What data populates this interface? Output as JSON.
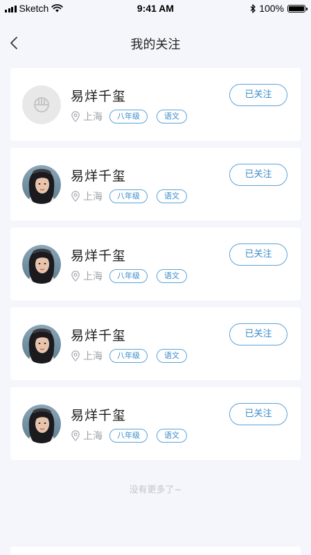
{
  "status_bar": {
    "carrier": "Sketch",
    "time": "9:41 AM",
    "battery": "100%"
  },
  "header": {
    "title": "我的关注"
  },
  "follows": [
    {
      "name": "易烊千玺",
      "city": "上海",
      "grade": "八年级",
      "subject": "语文",
      "button": "已关注",
      "avatar": "placeholder-logo"
    },
    {
      "name": "易烊千玺",
      "city": "上海",
      "grade": "八年级",
      "subject": "语文",
      "button": "已关注",
      "avatar": "photo"
    },
    {
      "name": "易烊千玺",
      "city": "上海",
      "grade": "八年级",
      "subject": "语文",
      "button": "已关注",
      "avatar": "photo"
    },
    {
      "name": "易烊千玺",
      "city": "上海",
      "grade": "八年级",
      "subject": "语文",
      "button": "已关注",
      "avatar": "photo"
    },
    {
      "name": "易烊千玺",
      "city": "上海",
      "grade": "八年级",
      "subject": "语文",
      "button": "已关注",
      "avatar": "photo"
    }
  ],
  "footer": {
    "end_text": "没有更多了~"
  },
  "colors": {
    "accent": "#3a8cc9",
    "accent_border": "#5aa2d8",
    "background": "#f4f6fb",
    "card": "#ffffff"
  }
}
